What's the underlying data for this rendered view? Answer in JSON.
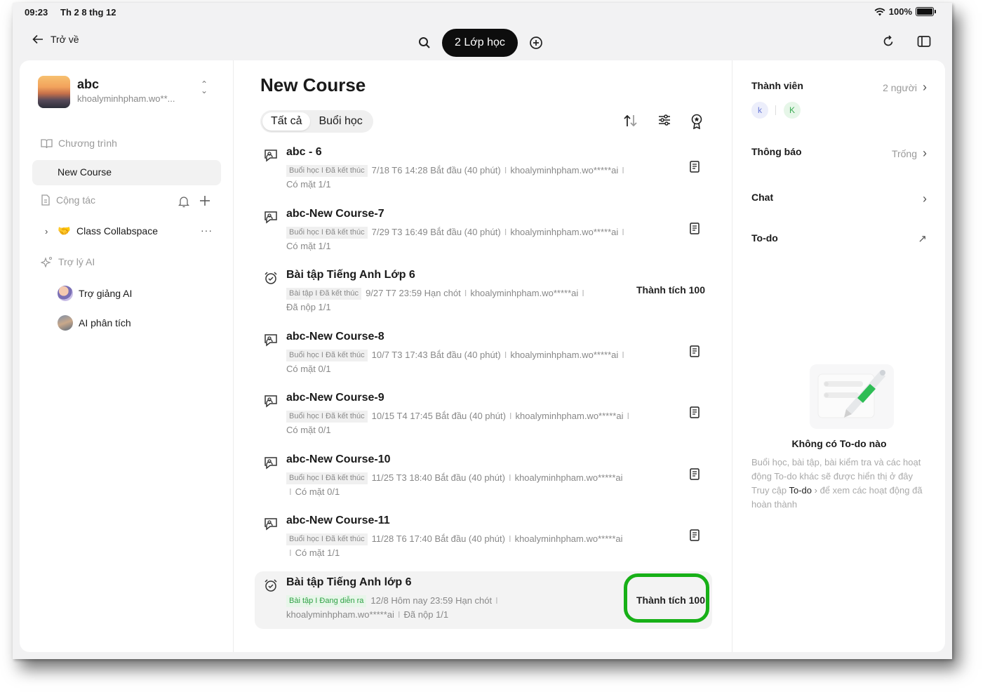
{
  "status": {
    "time": "09:23",
    "date": "Th 2 8 thg 12",
    "battery": "100%"
  },
  "topbar": {
    "back_label": "Trở về",
    "pill_label": "2 Lớp học"
  },
  "profile": {
    "name": "abc",
    "email": "khoalyminhpham.wo**..."
  },
  "sidebar": {
    "program_label": "Chương trình",
    "active_course": "New Course",
    "collab_label": "Cộng tác",
    "collabspace_label": "Class Collabspace",
    "ai_label": "Trợ lý AI",
    "ai_items": [
      {
        "label": "Trợ giảng AI"
      },
      {
        "label": "AI phân tích"
      }
    ]
  },
  "main": {
    "title": "New Course",
    "tabs": [
      {
        "label": "Tất cả"
      },
      {
        "label": "Buổi học"
      }
    ],
    "items": [
      {
        "title": "abc - 6",
        "tag": "Buổi học I Đã kết thúc",
        "time": "7/18 T6 14:28 Bắt đầu (40 phút)",
        "owner": "khoalyminhpham.wo*****ai",
        "status": "Có mặt  1/1"
      },
      {
        "title": "abc-New Course-7",
        "tag": "Buổi học I Đã kết thúc",
        "time": "7/29 T3 16:49 Bắt đầu (40 phút)",
        "owner": "khoalyminhpham.wo*****ai",
        "status": "Có mặt  1/1"
      },
      {
        "title": "Bài tập Tiếng Anh Lớp 6",
        "tag": "Bài tập I Đã kết thúc",
        "time": "9/27 T7 23:59 Hạn chót",
        "owner": "khoalyminhpham.wo*****ai",
        "status": "Đã nộp  1/1",
        "score": "Thành tích 100"
      },
      {
        "title": "abc-New Course-8",
        "tag": "Buổi học I Đã kết thúc",
        "time": "10/7 T3 17:43 Bắt đầu (40 phút)",
        "owner": "khoalyminhpham.wo*****ai",
        "status": "Có mặt  0/1"
      },
      {
        "title": "abc-New Course-9",
        "tag": "Buổi học I Đã kết thúc",
        "time": "10/15 T4 17:45 Bắt đầu (40 phút)",
        "owner": "khoalyminhpham.wo*****ai",
        "status": "Có mặt  0/1"
      },
      {
        "title": "abc-New Course-10",
        "tag": "Buổi học I Đã kết thúc",
        "time": "11/25 T3 18:40 Bắt đầu (40 phút)",
        "owner": "khoalyminhpham.wo*****ai",
        "status": "Có mặt  0/1"
      },
      {
        "title": "abc-New Course-11",
        "tag": "Buổi học I Đã kết thúc",
        "time": "11/28 T6 17:40 Bắt đầu (40 phút)",
        "owner": "khoalyminhpham.wo*****ai",
        "status": "Có mặt  1/1"
      },
      {
        "title": "Bài tập Tiếng Anh lớp 6",
        "tag": "Bài tập I Đang diễn ra",
        "time": "12/8 Hôm nay 23:59 Hạn chót",
        "owner": "khoalyminhpham.wo*****ai",
        "status": "Đã nộp  1/1",
        "score": "Thành tích 100"
      }
    ]
  },
  "right": {
    "members_label": "Thành viên",
    "members_value": "2 người",
    "member_initials": [
      "k",
      "K"
    ],
    "notice_label": "Thông báo",
    "notice_value": "Trống",
    "chat_label": "Chat",
    "todo_label": "To-do",
    "empty_title": "Không có To-do nào",
    "empty_desc": "Buổi học, bài tập, bài kiểm tra và các hoạt động To-do khác sẽ được hiển thị ở đây",
    "empty_link_pre": "Truy cập",
    "empty_link": "To-do",
    "empty_link_post": "để xem các hoạt động đã hoàn thành"
  }
}
